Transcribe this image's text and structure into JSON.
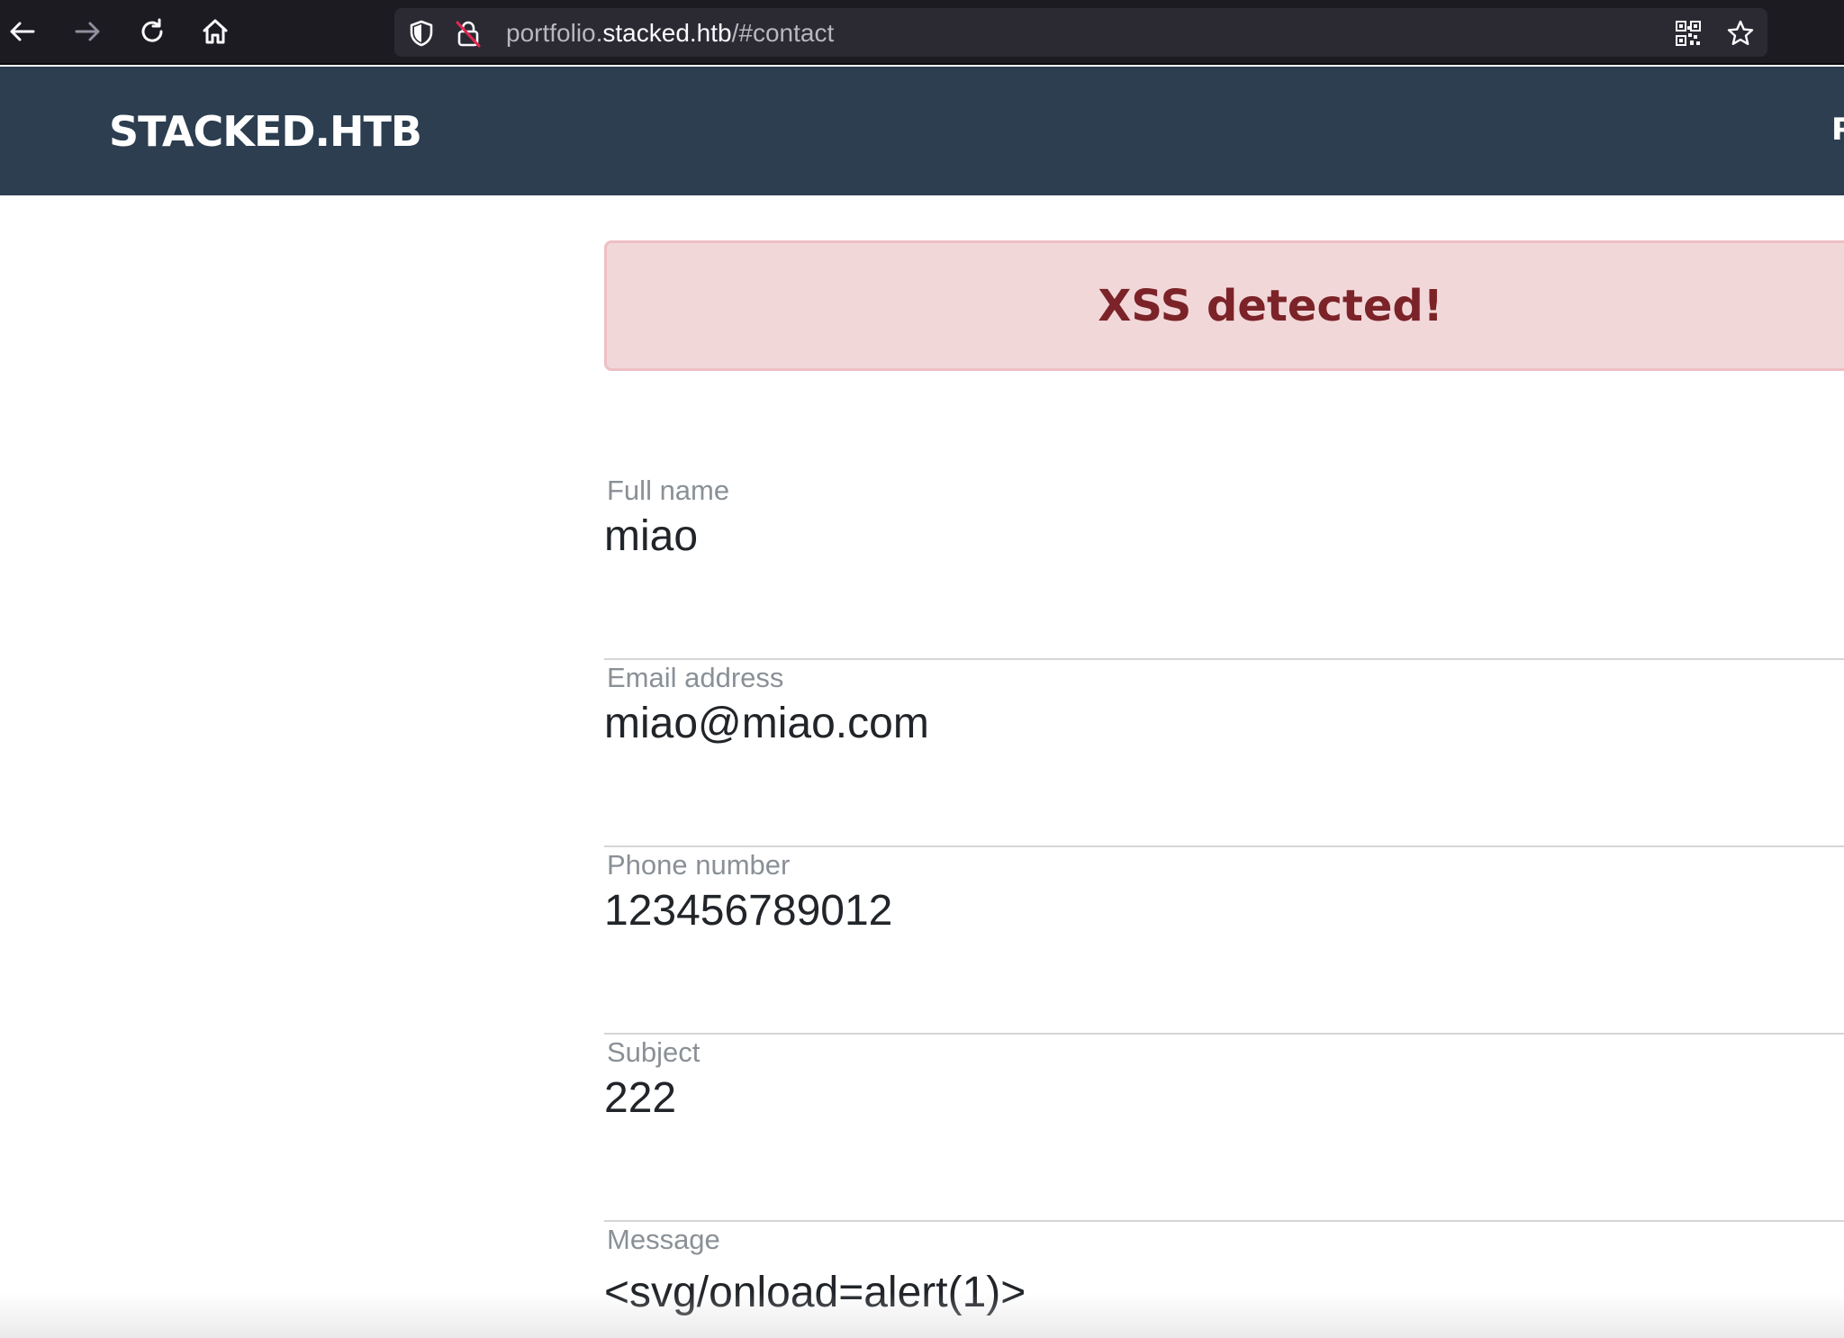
{
  "browser": {
    "url_prefix": "portfolio.",
    "url_domain": "stacked.htb",
    "url_suffix": "/#contact",
    "icons": {
      "back": "back-arrow-icon",
      "forward": "forward-arrow-icon",
      "reload": "reload-icon",
      "home": "home-icon",
      "shield": "shield-icon",
      "insecure": "insecure-lock-icon",
      "qr": "qr-code-icon",
      "bookmark": "star-icon"
    },
    "colors": {
      "toolbar": "#1c1b22",
      "urlbar": "#2b2a33"
    }
  },
  "site": {
    "brand": "STACKED.HTB",
    "nav_partial": "P",
    "navbar_color": "#2c3e50"
  },
  "alert": {
    "text": "XSS detected!",
    "background": "#f2d7d9",
    "text_color": "#7b2328"
  },
  "form": {
    "fields": [
      {
        "label": "Full name",
        "value": "miao"
      },
      {
        "label": "Email address",
        "value": "miao@miao.com"
      },
      {
        "label": "Phone number",
        "value": "123456789012"
      },
      {
        "label": "Subject",
        "value": "222"
      },
      {
        "label": "Message",
        "value": "<svg/onload=alert(1)>"
      }
    ]
  }
}
